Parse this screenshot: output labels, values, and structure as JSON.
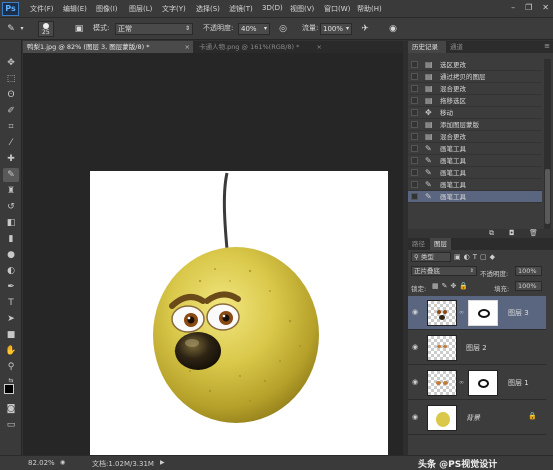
{
  "app": {
    "logo": "Ps"
  },
  "menu": [
    "文件(F)",
    "编辑(E)",
    "图像(I)",
    "图层(L)",
    "文字(Y)",
    "选择(S)",
    "滤镜(T)",
    "3D(D)",
    "视图(V)",
    "窗口(W)",
    "帮助(H)"
  ],
  "options": {
    "brush_size": "25",
    "mode_label": "模式:",
    "mode_value": "正常",
    "opacity_label": "不透明度:",
    "opacity_value": "40%",
    "flow_label": "流量:",
    "flow_value": "100%"
  },
  "tabs": [
    {
      "label": "鸭梨1.jpg @ 82% (图层 3, 图层蒙版/8) *",
      "active": true
    },
    {
      "label": "卡通人物.png @ 161%(RGB/8) *",
      "active": false
    }
  ],
  "history_panel": {
    "tabs": [
      "历史记录",
      "通道"
    ],
    "items": [
      {
        "icon": "document-icon",
        "label": "选区更改"
      },
      {
        "icon": "document-icon",
        "label": "通过拷贝的图层"
      },
      {
        "icon": "document-icon",
        "label": "混合更改"
      },
      {
        "icon": "document-icon",
        "label": "拖移选区"
      },
      {
        "icon": "move-icon",
        "label": "移动"
      },
      {
        "icon": "document-icon",
        "label": "添加图层蒙版"
      },
      {
        "icon": "document-icon",
        "label": "混合更改"
      },
      {
        "icon": "brush-icon",
        "label": "画笔工具"
      },
      {
        "icon": "brush-icon",
        "label": "画笔工具"
      },
      {
        "icon": "brush-icon",
        "label": "画笔工具"
      },
      {
        "icon": "brush-icon",
        "label": "画笔工具"
      },
      {
        "icon": "brush-icon",
        "label": "画笔工具"
      }
    ],
    "selected_index": 11
  },
  "layers_panel": {
    "tabs": [
      "路径",
      "图层"
    ],
    "filter_label": "类型",
    "blend_mode": "正片叠底",
    "opacity_label": "不透明度:",
    "opacity_value": "100%",
    "lock_label": "锁定:",
    "fill_label": "填充:",
    "fill_value": "100%",
    "layers": [
      {
        "name": "图层 3",
        "has_mask": true,
        "selected": true
      },
      {
        "name": "图层 2",
        "has_mask": false,
        "selected": false
      },
      {
        "name": "图层 1",
        "has_mask": true,
        "selected": false
      },
      {
        "name": "背景",
        "has_mask": false,
        "selected": false,
        "locked": true
      }
    ]
  },
  "status": {
    "zoom": "82.02%",
    "doc_info": "文档:1.02M/3.31M",
    "watermark": "头条 @PS视觉设计"
  },
  "colors": {
    "selection_highlight": "#5a6580",
    "pear_yellow": "#d9c84a"
  }
}
